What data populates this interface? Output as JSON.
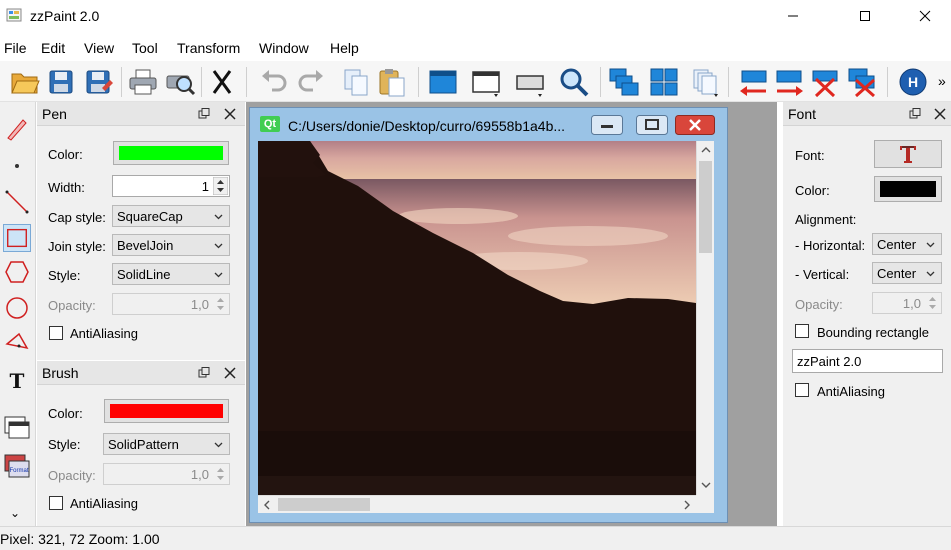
{
  "window": {
    "title": "zzPaint 2.0",
    "minimize_glyph": "—",
    "maximize_glyph": "☐",
    "close_glyph": "✕"
  },
  "menu": [
    "File",
    "Edit",
    "View",
    "Tool",
    "Transform",
    "Window",
    "Help"
  ],
  "toolbar": {
    "icons": [
      "open-icon",
      "save-icon",
      "save-as-icon",
      "print-icon",
      "print-preview-icon",
      "cut-icon",
      "undo-icon",
      "redo-icon",
      "copy-icon",
      "paste-icon",
      "new-window-icon",
      "window-resize-icon",
      "window-shrink-icon",
      "zoom-icon",
      "cascade-icon",
      "tile-icon",
      "stack-pages-icon",
      "flip-horizontal-icon",
      "flip-vertical-icon",
      "delete-icon",
      "delete-all-icon",
      "help-icon"
    ],
    "help_letter": "H",
    "overflow_glyph": "»"
  },
  "tools": {
    "icons": [
      "pen-tool-icon",
      "point-tool-icon",
      "line-tool-icon",
      "rectangle-tool-icon",
      "polygon-tool-icon",
      "ellipse-tool-icon",
      "pie-tool-icon",
      "text-tool-icon",
      "layers-icon",
      "format-icon",
      "more-tools-icon"
    ],
    "text_letter": "T",
    "format_label": "Format",
    "more_glyph": "⌄",
    "selected": "rectangle-tool-icon"
  },
  "pen_panel": {
    "title": "Pen",
    "color_label": "Color:",
    "color": "#00ff00",
    "width_label": "Width:",
    "width_value": "1",
    "cap_label": "Cap style:",
    "cap_value": "SquareCap",
    "join_label": "Join style:",
    "join_value": "BevelJoin",
    "style_label": "Style:",
    "style_value": "SolidLine",
    "opacity_label": "Opacity:",
    "opacity_value": "1,0",
    "antialias_label": "AntiAliasing"
  },
  "brush_panel": {
    "title": "Brush",
    "color_label": "Color:",
    "color": "#ff0000",
    "style_label": "Style:",
    "style_value": "SolidPattern",
    "opacity_label": "Opacity:",
    "opacity_value": "1,0",
    "antialias_label": "AntiAliasing"
  },
  "font_panel": {
    "title": "Font",
    "font_label": "Font:",
    "color_label": "Color:",
    "color": "#000000",
    "alignment_label": "Alignment:",
    "horizontal_label": "- Horizontal:",
    "horizontal_value": "Center",
    "vertical_label": "- Vertical:",
    "vertical_value": "Center",
    "opacity_label": "Opacity:",
    "opacity_value": "1,0",
    "bounding_label": "Bounding rectangle",
    "text_value": "zzPaint 2.0",
    "antialias_label": "AntiAliasing"
  },
  "document": {
    "qt_badge": "Qt",
    "path": "C:/Users/donie/Desktop/curro/69558b1a4b..."
  },
  "status": {
    "text": "Pixel: 321, 72  Zoom: 1.00"
  }
}
